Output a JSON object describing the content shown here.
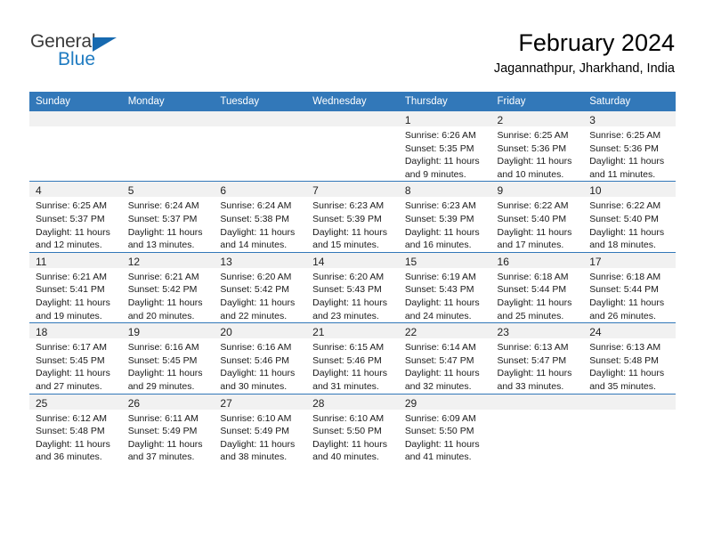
{
  "logo": {
    "word_one": "General",
    "word_two": "Blue",
    "triangle_icon": "triangle-icon",
    "brand_color": "#176ab0",
    "text_color": "#3b3b3b"
  },
  "header": {
    "title": "February 2024",
    "location": "Jagannathpur, Jharkhand, India"
  },
  "theme": {
    "header_blue": "#3278b9",
    "daynum_band": "#f1f1f1",
    "cell_background": "#ffffff"
  },
  "calendar": {
    "columns": [
      "Sunday",
      "Monday",
      "Tuesday",
      "Wednesday",
      "Thursday",
      "Friday",
      "Saturday"
    ],
    "weeks": [
      [
        {
          "day": "",
          "lines": []
        },
        {
          "day": "",
          "lines": []
        },
        {
          "day": "",
          "lines": []
        },
        {
          "day": "",
          "lines": []
        },
        {
          "day": "1",
          "lines": [
            "Sunrise: 6:26 AM",
            "Sunset: 5:35 PM",
            "Daylight: 11 hours",
            "and 9 minutes."
          ]
        },
        {
          "day": "2",
          "lines": [
            "Sunrise: 6:25 AM",
            "Sunset: 5:36 PM",
            "Daylight: 11 hours",
            "and 10 minutes."
          ]
        },
        {
          "day": "3",
          "lines": [
            "Sunrise: 6:25 AM",
            "Sunset: 5:36 PM",
            "Daylight: 11 hours",
            "and 11 minutes."
          ]
        }
      ],
      [
        {
          "day": "4",
          "lines": [
            "Sunrise: 6:25 AM",
            "Sunset: 5:37 PM",
            "Daylight: 11 hours",
            "and 12 minutes."
          ]
        },
        {
          "day": "5",
          "lines": [
            "Sunrise: 6:24 AM",
            "Sunset: 5:37 PM",
            "Daylight: 11 hours",
            "and 13 minutes."
          ]
        },
        {
          "day": "6",
          "lines": [
            "Sunrise: 6:24 AM",
            "Sunset: 5:38 PM",
            "Daylight: 11 hours",
            "and 14 minutes."
          ]
        },
        {
          "day": "7",
          "lines": [
            "Sunrise: 6:23 AM",
            "Sunset: 5:39 PM",
            "Daylight: 11 hours",
            "and 15 minutes."
          ]
        },
        {
          "day": "8",
          "lines": [
            "Sunrise: 6:23 AM",
            "Sunset: 5:39 PM",
            "Daylight: 11 hours",
            "and 16 minutes."
          ]
        },
        {
          "day": "9",
          "lines": [
            "Sunrise: 6:22 AM",
            "Sunset: 5:40 PM",
            "Daylight: 11 hours",
            "and 17 minutes."
          ]
        },
        {
          "day": "10",
          "lines": [
            "Sunrise: 6:22 AM",
            "Sunset: 5:40 PM",
            "Daylight: 11 hours",
            "and 18 minutes."
          ]
        }
      ],
      [
        {
          "day": "11",
          "lines": [
            "Sunrise: 6:21 AM",
            "Sunset: 5:41 PM",
            "Daylight: 11 hours",
            "and 19 minutes."
          ]
        },
        {
          "day": "12",
          "lines": [
            "Sunrise: 6:21 AM",
            "Sunset: 5:42 PM",
            "Daylight: 11 hours",
            "and 20 minutes."
          ]
        },
        {
          "day": "13",
          "lines": [
            "Sunrise: 6:20 AM",
            "Sunset: 5:42 PM",
            "Daylight: 11 hours",
            "and 22 minutes."
          ]
        },
        {
          "day": "14",
          "lines": [
            "Sunrise: 6:20 AM",
            "Sunset: 5:43 PM",
            "Daylight: 11 hours",
            "and 23 minutes."
          ]
        },
        {
          "day": "15",
          "lines": [
            "Sunrise: 6:19 AM",
            "Sunset: 5:43 PM",
            "Daylight: 11 hours",
            "and 24 minutes."
          ]
        },
        {
          "day": "16",
          "lines": [
            "Sunrise: 6:18 AM",
            "Sunset: 5:44 PM",
            "Daylight: 11 hours",
            "and 25 minutes."
          ]
        },
        {
          "day": "17",
          "lines": [
            "Sunrise: 6:18 AM",
            "Sunset: 5:44 PM",
            "Daylight: 11 hours",
            "and 26 minutes."
          ]
        }
      ],
      [
        {
          "day": "18",
          "lines": [
            "Sunrise: 6:17 AM",
            "Sunset: 5:45 PM",
            "Daylight: 11 hours",
            "and 27 minutes."
          ]
        },
        {
          "day": "19",
          "lines": [
            "Sunrise: 6:16 AM",
            "Sunset: 5:45 PM",
            "Daylight: 11 hours",
            "and 29 minutes."
          ]
        },
        {
          "day": "20",
          "lines": [
            "Sunrise: 6:16 AM",
            "Sunset: 5:46 PM",
            "Daylight: 11 hours",
            "and 30 minutes."
          ]
        },
        {
          "day": "21",
          "lines": [
            "Sunrise: 6:15 AM",
            "Sunset: 5:46 PM",
            "Daylight: 11 hours",
            "and 31 minutes."
          ]
        },
        {
          "day": "22",
          "lines": [
            "Sunrise: 6:14 AM",
            "Sunset: 5:47 PM",
            "Daylight: 11 hours",
            "and 32 minutes."
          ]
        },
        {
          "day": "23",
          "lines": [
            "Sunrise: 6:13 AM",
            "Sunset: 5:47 PM",
            "Daylight: 11 hours",
            "and 33 minutes."
          ]
        },
        {
          "day": "24",
          "lines": [
            "Sunrise: 6:13 AM",
            "Sunset: 5:48 PM",
            "Daylight: 11 hours",
            "and 35 minutes."
          ]
        }
      ],
      [
        {
          "day": "25",
          "lines": [
            "Sunrise: 6:12 AM",
            "Sunset: 5:48 PM",
            "Daylight: 11 hours",
            "and 36 minutes."
          ]
        },
        {
          "day": "26",
          "lines": [
            "Sunrise: 6:11 AM",
            "Sunset: 5:49 PM",
            "Daylight: 11 hours",
            "and 37 minutes."
          ]
        },
        {
          "day": "27",
          "lines": [
            "Sunrise: 6:10 AM",
            "Sunset: 5:49 PM",
            "Daylight: 11 hours",
            "and 38 minutes."
          ]
        },
        {
          "day": "28",
          "lines": [
            "Sunrise: 6:10 AM",
            "Sunset: 5:50 PM",
            "Daylight: 11 hours",
            "and 40 minutes."
          ]
        },
        {
          "day": "29",
          "lines": [
            "Sunrise: 6:09 AM",
            "Sunset: 5:50 PM",
            "Daylight: 11 hours",
            "and 41 minutes."
          ]
        },
        {
          "day": "",
          "lines": []
        },
        {
          "day": "",
          "lines": []
        }
      ]
    ]
  }
}
